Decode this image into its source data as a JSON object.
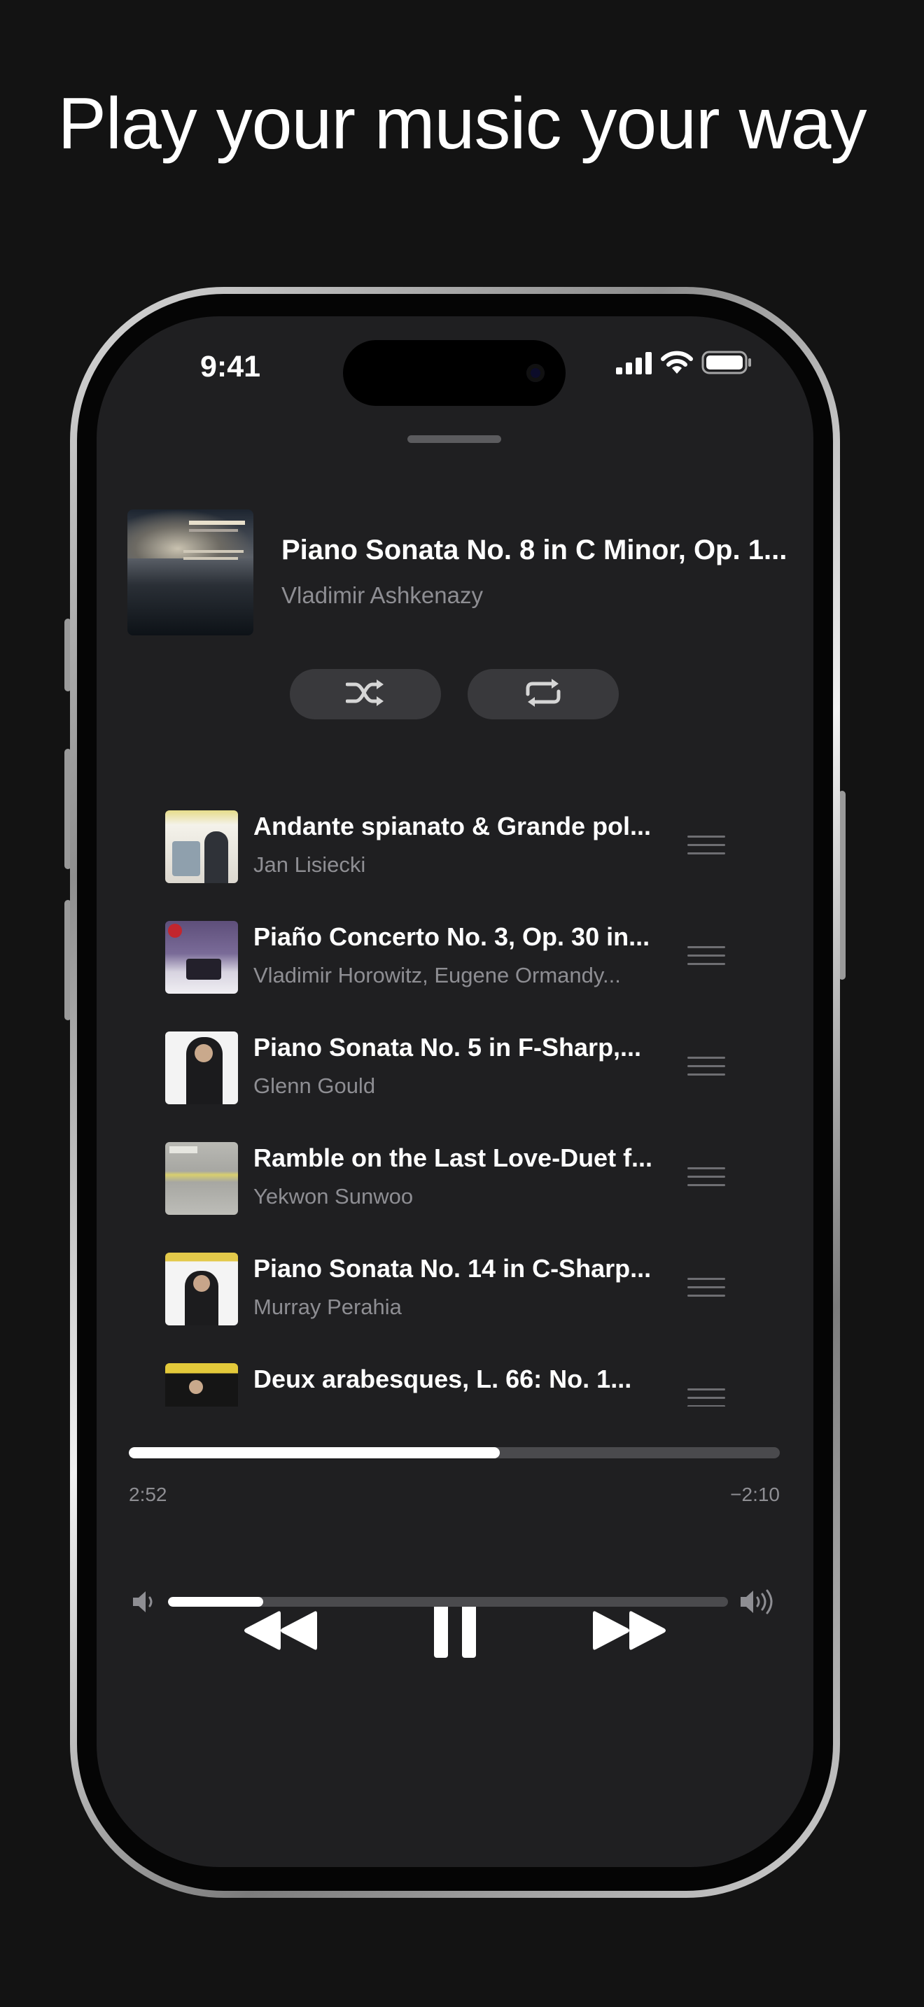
{
  "headline": "Play your music your way",
  "status_bar": {
    "time": "9:41",
    "icons": [
      "signal-icon",
      "wifi-icon",
      "battery-icon"
    ]
  },
  "now_playing": {
    "title": "Piano Sonata No. 8 in C Minor, Op. 1...",
    "artist": "Vladimir Ashkenazy",
    "buttons": [
      "shuffle-icon",
      "repeat-icon"
    ]
  },
  "queue": [
    {
      "title": "Andante spianato & Grande pol...",
      "artist": "Jan Lisiecki"
    },
    {
      "title": "Piaño Concerto No. 3, Op. 30 in...",
      "artist": "Vladimir Horowitz, Eugene Ormandy..."
    },
    {
      "title": "Piano Sonata No. 5 in F-Sharp,...",
      "artist": "Glenn Gould"
    },
    {
      "title": "Ramble on the Last Love-Duet f...",
      "artist": "Yekwon Sunwoo"
    },
    {
      "title": "Piano Sonata No. 14 in C-Sharp...",
      "artist": "Murray Perahia"
    },
    {
      "title": "Deux arabesques, L. 66: No. 1...",
      "artist": ""
    }
  ],
  "playback": {
    "elapsed": "2:52",
    "remaining": "−2:10",
    "progress": 0.57
  },
  "controls": [
    "rewind-icon",
    "pause-icon",
    "fast-forward-icon"
  ],
  "volume": {
    "level": 0.17,
    "icons": [
      "volume-low-icon",
      "volume-high-icon"
    ]
  },
  "colors": {
    "background": "#131313",
    "screen": "#1f1f21",
    "secondary_text": "#8e8e93",
    "accent": "#ffffff"
  }
}
